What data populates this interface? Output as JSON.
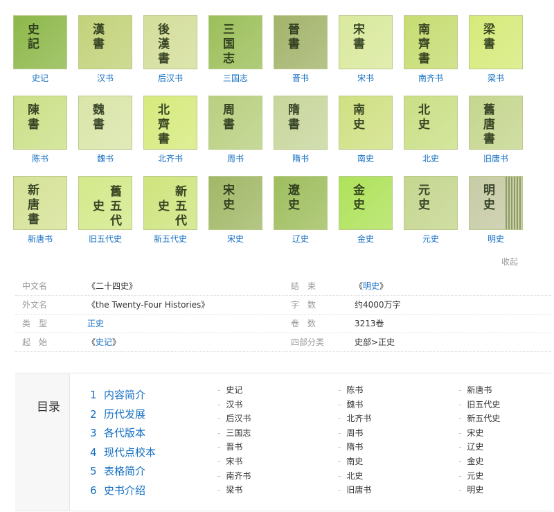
{
  "books": [
    {
      "label": "史记",
      "glyphs": "史記",
      "color": "#8db84a"
    },
    {
      "label": "汉书",
      "glyphs": "漢書",
      "color": "#c2d27a"
    },
    {
      "label": "后汉书",
      "glyphs": "後漢書",
      "color": "#d4de9a"
    },
    {
      "label": "三国志",
      "glyphs": "三国志",
      "color": "#9cbf5a"
    },
    {
      "label": "晋书",
      "glyphs": "晉書",
      "color": "#a3b46b"
    },
    {
      "label": "宋书",
      "glyphs": "宋書",
      "color": "#d9e99c"
    },
    {
      "label": "南齐书",
      "glyphs": "南齊書",
      "color": "#c7dc72"
    },
    {
      "label": "梁书",
      "glyphs": "梁書",
      "color": "#d6ea7a"
    },
    {
      "label": "陈书",
      "glyphs": "陳書",
      "color": "#cbe088"
    },
    {
      "label": "魏书",
      "glyphs": "魏書",
      "color": "#d9e5a8"
    },
    {
      "label": "北齐书",
      "glyphs": "北齊書",
      "color": "#d6ea7d"
    },
    {
      "label": "周书",
      "glyphs": "周書",
      "color": "#b9cf80"
    },
    {
      "label": "隋书",
      "glyphs": "隋書",
      "color": "#c8d69c"
    },
    {
      "label": "南史",
      "glyphs": "南史",
      "color": "#cfe082"
    },
    {
      "label": "北史",
      "glyphs": "北史",
      "color": "#cadf86"
    },
    {
      "label": "旧唐书",
      "glyphs": "舊唐書",
      "color": "#c5d68e"
    },
    {
      "label": "新唐书",
      "glyphs": "新唐書",
      "color": "#d5e296"
    },
    {
      "label": "旧五代史",
      "glyphs": "舊五代史",
      "color": "#d3e98a"
    },
    {
      "label": "新五代史",
      "glyphs": "新五代史",
      "color": "#cfe47e"
    },
    {
      "label": "宋史",
      "glyphs": "宋史",
      "color": "#a2b867"
    },
    {
      "label": "辽史",
      "glyphs": "遼史",
      "color": "#9fbe5e"
    },
    {
      "label": "金史",
      "glyphs": "金史",
      "color": "#aee25a"
    },
    {
      "label": "元史",
      "glyphs": "元史",
      "color": "#c5d68f"
    },
    {
      "label": "明史",
      "glyphs": "明史",
      "color": "#c7cba5"
    }
  ],
  "collapse_label": "收起",
  "info": [
    {
      "k1": "中文名",
      "v1": "《二十四史》",
      "v1_link": false,
      "k2": "结　束",
      "v2_pre": "《",
      "v2_link": "明史",
      "v2_post": "》"
    },
    {
      "k1": "外文名",
      "v1": "《the Twenty-Four Histories》",
      "v1_link": false,
      "k2": "字　数",
      "v2": "约4000万字"
    },
    {
      "k1": "类　型",
      "v1": "正史",
      "v1_link": true,
      "k2": "卷　数",
      "v2": "3213卷"
    },
    {
      "k1": "起　始",
      "v1_pre": "《",
      "v1_link_text": "史记",
      "v1_post": "》",
      "k2": "四部分类",
      "v2": "史部>正史"
    }
  ],
  "catalog": {
    "title": "目录",
    "toc": [
      {
        "num": "1",
        "label": "内容简介"
      },
      {
        "num": "2",
        "label": "历代发展"
      },
      {
        "num": "3",
        "label": "各代版本"
      },
      {
        "num": "4",
        "label": "现代点校本"
      },
      {
        "num": "5",
        "label": "表格简介"
      },
      {
        "num": "6",
        "label": "史书介绍"
      }
    ],
    "sub_columns": [
      [
        "史记",
        "汉书",
        "后汉书",
        "三国志",
        "晋书",
        "宋书",
        "南齐书",
        "梁书"
      ],
      [
        "陈书",
        "魏书",
        "北齐书",
        "周书",
        "隋书",
        "南史",
        "北史",
        "旧唐书"
      ],
      [
        "新唐书",
        "旧五代史",
        "新五代史",
        "宋史",
        "辽史",
        "金史",
        "元史",
        "明史"
      ]
    ]
  }
}
